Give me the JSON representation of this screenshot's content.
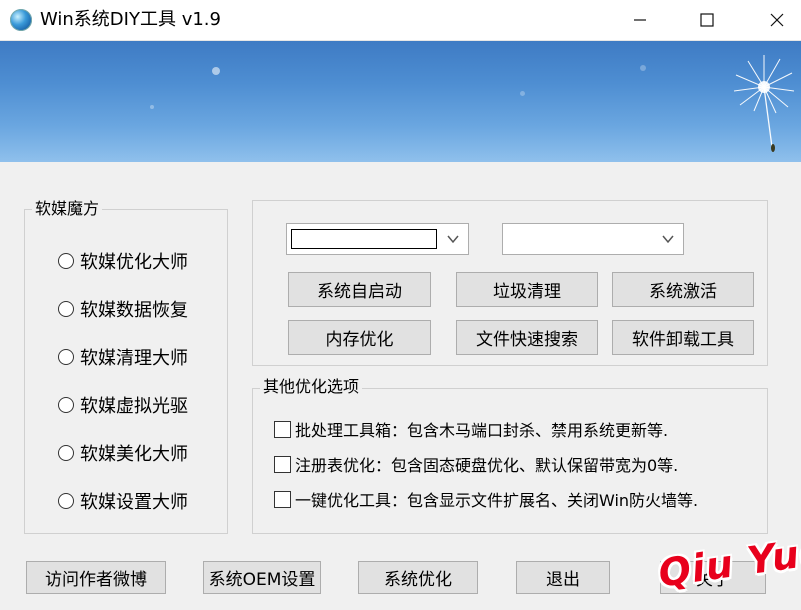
{
  "window": {
    "title": "Win系统DIY工具 v1.9",
    "controls": [
      "minimize",
      "maximize",
      "close"
    ]
  },
  "colors": {
    "banner_top": "#3e7bc4",
    "banner_bottom": "#8fc0ec",
    "button_face": "#e1e1e1",
    "watermark": "#e8001c"
  },
  "software_group": {
    "title": "软媒魔方",
    "options": [
      "软媒优化大师",
      "软媒数据恢复",
      "软媒清理大师",
      "软媒虚拟光驱",
      "软媒美化大师",
      "软媒设置大师"
    ]
  },
  "tools_group": {
    "combo_left_value": "",
    "combo_right_value": "",
    "buttons": [
      "系统自启动",
      "垃圾清理",
      "系统激活",
      "内存优化",
      "文件快速搜索",
      "软件卸载工具"
    ]
  },
  "other_group": {
    "title": "其他优化选项",
    "checks": [
      "批处理工具箱：包含木马端口封杀、禁用系统更新等.",
      "注册表优化：包含固态硬盘优化、默认保留带宽为0等.",
      "一键优化工具：包含显示文件扩展名、关闭Win防火墙等."
    ]
  },
  "bottom_buttons": {
    "visit": "访问作者微博",
    "oem": "系统OEM设置",
    "optimize": "系统优化",
    "exit": "退出",
    "about": "关于"
  },
  "watermark": "Qiu Yue"
}
